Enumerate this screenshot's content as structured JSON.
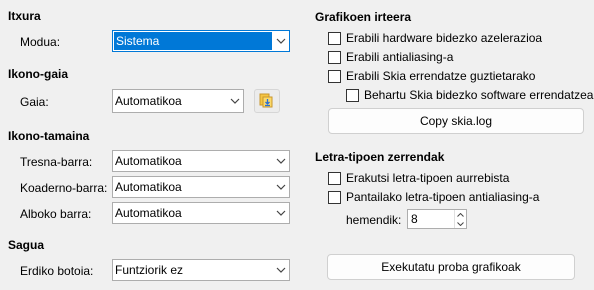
{
  "left": {
    "itxura": {
      "title": "Itxura",
      "modua_label": "Modua:",
      "modua_value": "Sistema"
    },
    "ikono_gaia": {
      "title": "Ikono-gaia",
      "gaia_label": "Gaia:",
      "gaia_value": "Automatikoa"
    },
    "ikono_tamaina": {
      "title": "Ikono-tamaina",
      "tresna_label": "Tresna-barra:",
      "tresna_value": "Automatikoa",
      "koaderno_label": "Koaderno-barra:",
      "koaderno_value": "Automatikoa",
      "alboko_label": "Alboko barra:",
      "alboko_value": "Automatikoa"
    },
    "sagua": {
      "title": "Sagua",
      "erdiko_label": "Erdiko botoia:",
      "erdiko_value": "Funtziorik ez"
    }
  },
  "right": {
    "grafikoen": {
      "title": "Grafikoen irteera",
      "hw_accel": "Erabili hardware bidezko azelerazioa",
      "antialias": "Erabili antialiasing-a",
      "skia": "Erabili Skia errendatze guztietarako",
      "skia_sw": "Behartu Skia bidezko software errendatzea",
      "copy_btn": "Copy skia.log"
    },
    "letra": {
      "title": "Letra-tipoen zerrendak",
      "aurrebista": "Erakutsi letra-tipoen aurrebista",
      "pantaila": "Pantailako letra-tipoen antialiasing-a",
      "hemendik_label": "hemendik:",
      "hemendik_value": "8"
    },
    "proba_btn": "Exekutatu proba grafikoak"
  },
  "icons": {
    "dropdown": "chevron-down-icon",
    "theme_install": "theme-install-icon"
  }
}
